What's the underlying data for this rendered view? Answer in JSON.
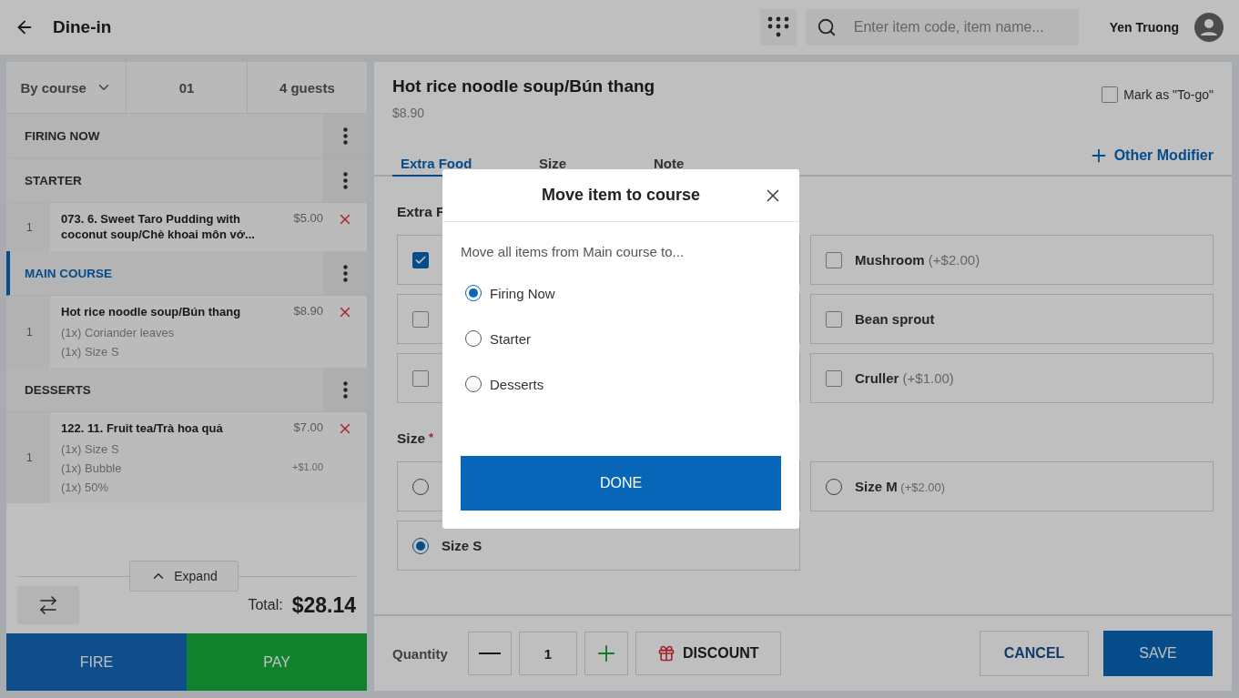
{
  "header": {
    "title": "Dine-in",
    "search": {
      "placeholder": "Enter item code, item name..."
    },
    "user": "Yen Truong"
  },
  "order": {
    "mode": "By course",
    "table": "01",
    "guests": "4 guests",
    "courses": [
      {
        "name": "FIRING NOW",
        "selected": false
      },
      {
        "name": "STARTER",
        "selected": false,
        "items": [
          {
            "qty": "1",
            "name": "073. 6. Sweet Taro Pudding with coconut soup/Chè khoai môn vớ...",
            "price": "$5.00"
          }
        ]
      },
      {
        "name": "MAIN COURSE",
        "selected": true,
        "items": [
          {
            "qty": "1",
            "name": "Hot rice noodle soup/Bún thang",
            "price": "$8.90",
            "modifiers": [
              {
                "text": "(1x) Coriander leaves"
              },
              {
                "text": "(1x) Size S"
              }
            ]
          }
        ]
      },
      {
        "name": "DESSERTS",
        "selected": false,
        "items": [
          {
            "qty": "1",
            "name": "122. 11. Fruit tea/Trà hoa quả",
            "price": "$7.00",
            "modifiers": [
              {
                "text": "(1x) Size S"
              },
              {
                "text": "(1x) Bubble",
                "price": "+$1.00"
              },
              {
                "text": "(1x) 50%"
              }
            ]
          }
        ]
      }
    ],
    "expand": "Expand",
    "total_label": "Total:",
    "total": "$28.14",
    "fire": "FIRE",
    "pay": "PAY"
  },
  "item": {
    "title": "Hot rice noodle soup/Bún thang",
    "price": "$8.90",
    "to_go": {
      "label": "Mark as \"To-go\"",
      "checked": false
    },
    "tabs": [
      {
        "label": "Extra Food",
        "selected": true
      },
      {
        "label": "Size",
        "selected": false
      },
      {
        "label": "Note",
        "selected": false
      }
    ],
    "other_modifier": "Other Modifier",
    "extra_food": {
      "heading": "Extra F",
      "options": [
        {
          "checked": true
        },
        {
          "label": "Mushroom",
          "price": "(+$2.00)",
          "checked": false
        },
        {
          "checked": false
        },
        {
          "label": "Bean sprout",
          "checked": false
        },
        {
          "checked": false
        },
        {
          "label": "Cruller",
          "price": "(+$1.00)",
          "checked": false
        }
      ]
    },
    "size": {
      "heading": "Size",
      "required_mark": "*",
      "options": [
        {
          "selected": false
        },
        {
          "label": "Size M",
          "price": "(+$2.00)",
          "selected": false
        },
        {
          "label": "Size S",
          "selected": true
        }
      ]
    },
    "quantity_label": "Quantity",
    "quantity": "1",
    "discount": "DISCOUNT",
    "cancel": "CANCEL",
    "save": "SAVE"
  },
  "dialog": {
    "title": "Move item to course",
    "prompt": "Move all items from Main course to...",
    "options": [
      {
        "label": "Firing Now",
        "selected": true
      },
      {
        "label": "Starter",
        "selected": false
      },
      {
        "label": "Desserts",
        "selected": false
      }
    ],
    "done": "DONE"
  }
}
